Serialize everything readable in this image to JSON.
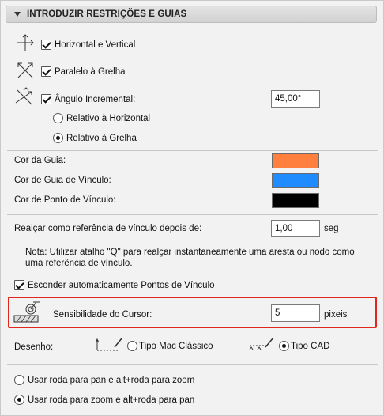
{
  "section": {
    "title": "INTRODUZIR RESTRIÇÕES E GUIAS"
  },
  "constraints": {
    "horizontal_vertical": {
      "label": "Horizontal e Vertical",
      "checked": true,
      "icon": "cross-arrows-icon"
    },
    "parallel_grid": {
      "label": "Paralelo à Grelha",
      "checked": true,
      "icon": "diagonal-cross-icon"
    },
    "incremental_angle": {
      "label": "Ângulo Incremental:",
      "checked": true,
      "value": "45,00°",
      "icon": "angle-icon"
    },
    "relative_options": [
      {
        "label": "Relativo à Horizontal",
        "selected": false
      },
      {
        "label": "Relativo à Grelha",
        "selected": true
      }
    ]
  },
  "colors": {
    "guide": {
      "label": "Cor da Guia:",
      "value": "#ff7f3f"
    },
    "snap_guide": {
      "label": "Cor de Guia de Vínculo:",
      "value": "#1e8cff"
    },
    "snap_point": {
      "label": "Cor de Ponto de Vínculo:",
      "value": "#000000"
    }
  },
  "highlight_delay": {
    "label": "Realçar como referência de vínculo depois de:",
    "value": "1,00",
    "unit": "seg"
  },
  "note": "Nota: Utilizar atalho \"Q\" para realçar instantaneamente uma aresta ou nodo como uma referência de vínculo.",
  "auto_hide": {
    "label": "Esconder automaticamente Pontos de Vínculo",
    "checked": true
  },
  "cursor_sensitivity": {
    "label": "Sensibilidade do Cursor:",
    "value": "5",
    "unit": "pixeis",
    "icon": "cursor-sensitivity-icon"
  },
  "drawing": {
    "label": "Desenho:",
    "options": [
      {
        "label": "Tipo Mac Clássico",
        "selected": false,
        "icon": "mac-classic-drawing-icon"
      },
      {
        "label": "Tipo CAD",
        "selected": true,
        "icon": "cad-drawing-icon"
      }
    ]
  },
  "wheel": [
    {
      "label": "Usar roda para pan e alt+roda para zoom",
      "selected": false
    },
    {
      "label": "Usar roda para zoom e alt+roda para pan",
      "selected": true
    }
  ],
  "accent": {
    "highlight_border": "#e1261c"
  }
}
